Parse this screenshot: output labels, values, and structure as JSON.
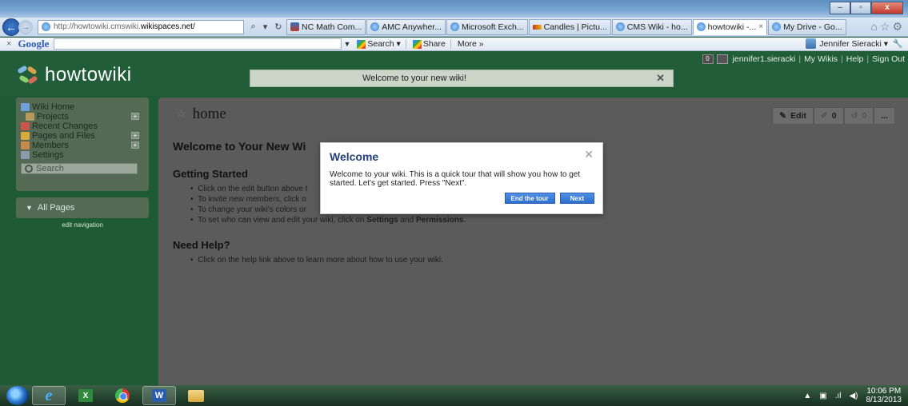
{
  "browser": {
    "address_prefix": "http://howtowiki.cmswiki.",
    "address_domain": "wikispaces.net/",
    "tabs": [
      {
        "label": "NC Math Com...",
        "icon": "nc-icon",
        "active": false
      },
      {
        "label": "AMC Anywher...",
        "icon": "ie-page-icon",
        "active": false
      },
      {
        "label": "Microsoft Exch...",
        "icon": "ie-page-icon",
        "active": false
      },
      {
        "label": "Candles | Pictu...",
        "icon": "candle-icon",
        "active": false
      },
      {
        "label": "CMS Wiki - ho...",
        "icon": "ie-page-icon",
        "active": false
      },
      {
        "label": "howtowiki -...",
        "icon": "ie-page-icon",
        "active": true
      },
      {
        "label": "My Drive - Go...",
        "icon": "ie-page-icon",
        "active": false
      }
    ],
    "google_label": "Google",
    "search_label": "Search",
    "share_label": "Share",
    "more_label": "More »",
    "user_name": "Jennifer Sieracki"
  },
  "wiki": {
    "logo_text": "howtowiki",
    "welcome_banner": "Welcome to your new wiki!",
    "account": {
      "count": "0",
      "username": "jennifer1.sieracki",
      "links": [
        "My Wikis",
        "Help",
        "Sign Out"
      ]
    },
    "sidebar": {
      "items": [
        {
          "label": "Wiki Home",
          "plus": false,
          "sub": false,
          "color": "#6f9fd8"
        },
        {
          "label": "Projects",
          "plus": true,
          "sub": true,
          "color": "#b59a5a"
        },
        {
          "label": "Recent Changes",
          "plus": false,
          "sub": false,
          "color": "#c8574a"
        },
        {
          "label": "Pages and Files",
          "plus": true,
          "sub": false,
          "color": "#d9a93c"
        },
        {
          "label": "Members",
          "plus": true,
          "sub": false,
          "color": "#c78a4a"
        },
        {
          "label": "Settings",
          "plus": false,
          "sub": false,
          "color": "#8a9aa8"
        }
      ],
      "search_placeholder": "Search",
      "all_pages": "All Pages",
      "edit_navigation": "edit navigation"
    },
    "page": {
      "title": "home",
      "edit_label": "Edit",
      "count_a": "0",
      "count_b": "0",
      "more": "...",
      "heading": "Welcome to Your New Wi",
      "getting_started": "Getting Started",
      "bullets": [
        "Click on the edit button above t",
        "To invite new members, click o",
        "To change your wiki's colors or"
      ],
      "bullet4_prefix": "To set who can view and edit your wiki, click on ",
      "bullet4_b1": "Settings",
      "bullet4_mid": " and ",
      "bullet4_b2": "Permissions",
      "bullet4_suffix": ".",
      "need_help": "Need Help?",
      "help_bullet": "Click on the help link above to learn more about how to use your wiki."
    },
    "modal": {
      "title": "Welcome",
      "body": "Welcome to your wiki. This is a quick tour that will show you how to get started. Let's get started. Press \"Next\".",
      "end_label": "End the tour",
      "next_label": "Next"
    }
  },
  "taskbar": {
    "time": "10:06 PM",
    "date": "8/13/2013"
  }
}
